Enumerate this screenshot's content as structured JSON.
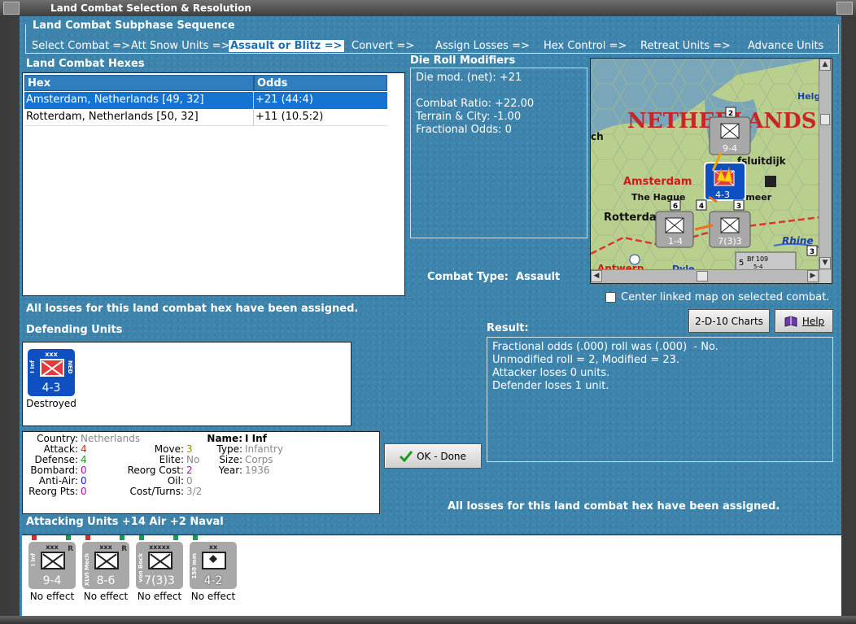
{
  "window": {
    "title": "Land Combat Selection & Resolution"
  },
  "sequence": {
    "title": "Land Combat Subphase Sequence",
    "steps": [
      {
        "label": "Select Combat =>"
      },
      {
        "label": "Att Snow Units =>"
      },
      {
        "label": "Assault or Blitz =>"
      },
      {
        "label": "Convert =>"
      },
      {
        "label": "Assign Losses =>"
      },
      {
        "label": "Hex Control =>"
      },
      {
        "label": "Retreat Units =>"
      },
      {
        "label": "Advance Units"
      }
    ],
    "active_index": 2
  },
  "hexes": {
    "title": "Land Combat Hexes",
    "col_hex": "Hex",
    "col_odds": "Odds",
    "rows": [
      {
        "hex": "Amsterdam, Netherlands [49, 32]",
        "odds": "+21 (44:4)",
        "selected": true
      },
      {
        "hex": "Rotterdam, Netherlands [50, 32]",
        "odds": "+11 (10.5:2)",
        "selected": false
      }
    ]
  },
  "die_roll": {
    "title": "Die Roll Modifiers",
    "net": "Die mod. (net): +21",
    "ratio": "Combat Ratio: +22.00",
    "terrain": "Terrain & City: -1.00",
    "fractional": "Fractional Odds: 0"
  },
  "combat_type": {
    "label": "Combat Type:",
    "value": "Assault"
  },
  "map": {
    "country_label": "NETHERLANDS",
    "cities": {
      "amsterdam": "Amsterdam",
      "hague": "The Hague",
      "rotterdam": "Rotterdam",
      "antwerp": "Antwerp",
      "ijsselmeer": "sselmeer",
      "afsluitdijk": "fsluitdijk",
      "helg": "Helg",
      "ch": "ch",
      "rhine": "Rhine",
      "dyle": "Dyle"
    },
    "units": {
      "top_strength": "9-4",
      "top_stack": "2",
      "mid_strength": "4-3",
      "mid_stack": "3",
      "left_strength": "1-4",
      "left_stack": "6",
      "right_strength": "7(3)3",
      "right_stack": "4",
      "br_stack": "5",
      "br_label": "Bf 109",
      "br_val": "5-4",
      "br_num": "3"
    },
    "center_checkbox_label": "Center linked map on selected combat.",
    "center_checked": false
  },
  "buttons": {
    "charts": "2-D-10 Charts",
    "help": "Help",
    "ok": "OK - Done"
  },
  "messages": {
    "losses_assigned": "All losses for this land combat hex have been assigned.",
    "losses_assigned_bottom": "All losses for this land combat hex have been assigned."
  },
  "defending": {
    "title": "Defending Units",
    "units": [
      {
        "size": "xxx",
        "name": "I Inf",
        "nation": "NED",
        "strength": "4-3",
        "status": "Destroyed"
      }
    ]
  },
  "unit_info": {
    "country_k": "Country:",
    "country_v": "Netherlands",
    "attack_k": "Attack:",
    "attack_v": "4",
    "defense_k": "Defense:",
    "defense_v": "4",
    "bombard_k": "Bombard:",
    "bombard_v": "0",
    "antiair_k": "Anti-Air:",
    "antiair_v": "0",
    "reorgpts_k": "Reorg Pts:",
    "reorgpts_v": "0",
    "move_k": "Move:",
    "move_v": "3",
    "elite_k": "Elite:",
    "elite_v": "No",
    "reorgcost_k": "Reorg Cost:",
    "reorgcost_v": "2",
    "oil_k": "Oil:",
    "oil_v": "0",
    "costturns_k": "Cost/Turns:",
    "costturns_v": "3/2",
    "name_k": "Name:",
    "name_v": "I Inf",
    "type_k": "Type:",
    "type_v": "Infantry",
    "size_k": "Size:",
    "size_v": "Corps",
    "year_k": "Year:",
    "year_v": "1936"
  },
  "result": {
    "title": "Result:",
    "lines": [
      "Fractional odds (.000) roll was (.000)  - No.",
      "Unmodified roll = 2, Modified = 23.",
      "Attacker loses 0 units.",
      "Defender loses 1 unit."
    ]
  },
  "attacking": {
    "title": "Attacking Units +14 Air +2 Naval",
    "units": [
      {
        "size": "xxx",
        "name": "I Inf",
        "tag": "R",
        "strength": "9-4",
        "status": "No effect"
      },
      {
        "size": "xxx",
        "name": "XLVI Mech",
        "tag": "R",
        "strength": "8-6",
        "status": "No effect"
      },
      {
        "size": "xxxxx",
        "name": "von Bock",
        "tag": "",
        "strength": "7(3)3",
        "status": "No effect"
      },
      {
        "size": "xx",
        "name": "150 mm",
        "tag": "",
        "strength": "4-2",
        "status": "No effect"
      }
    ]
  },
  "colors": {
    "panel_blue": "#3d84ad",
    "selection_blue": "#1574d2",
    "ned_counter": "#0e4fc1",
    "ger_counter": "#a8a8a8"
  }
}
